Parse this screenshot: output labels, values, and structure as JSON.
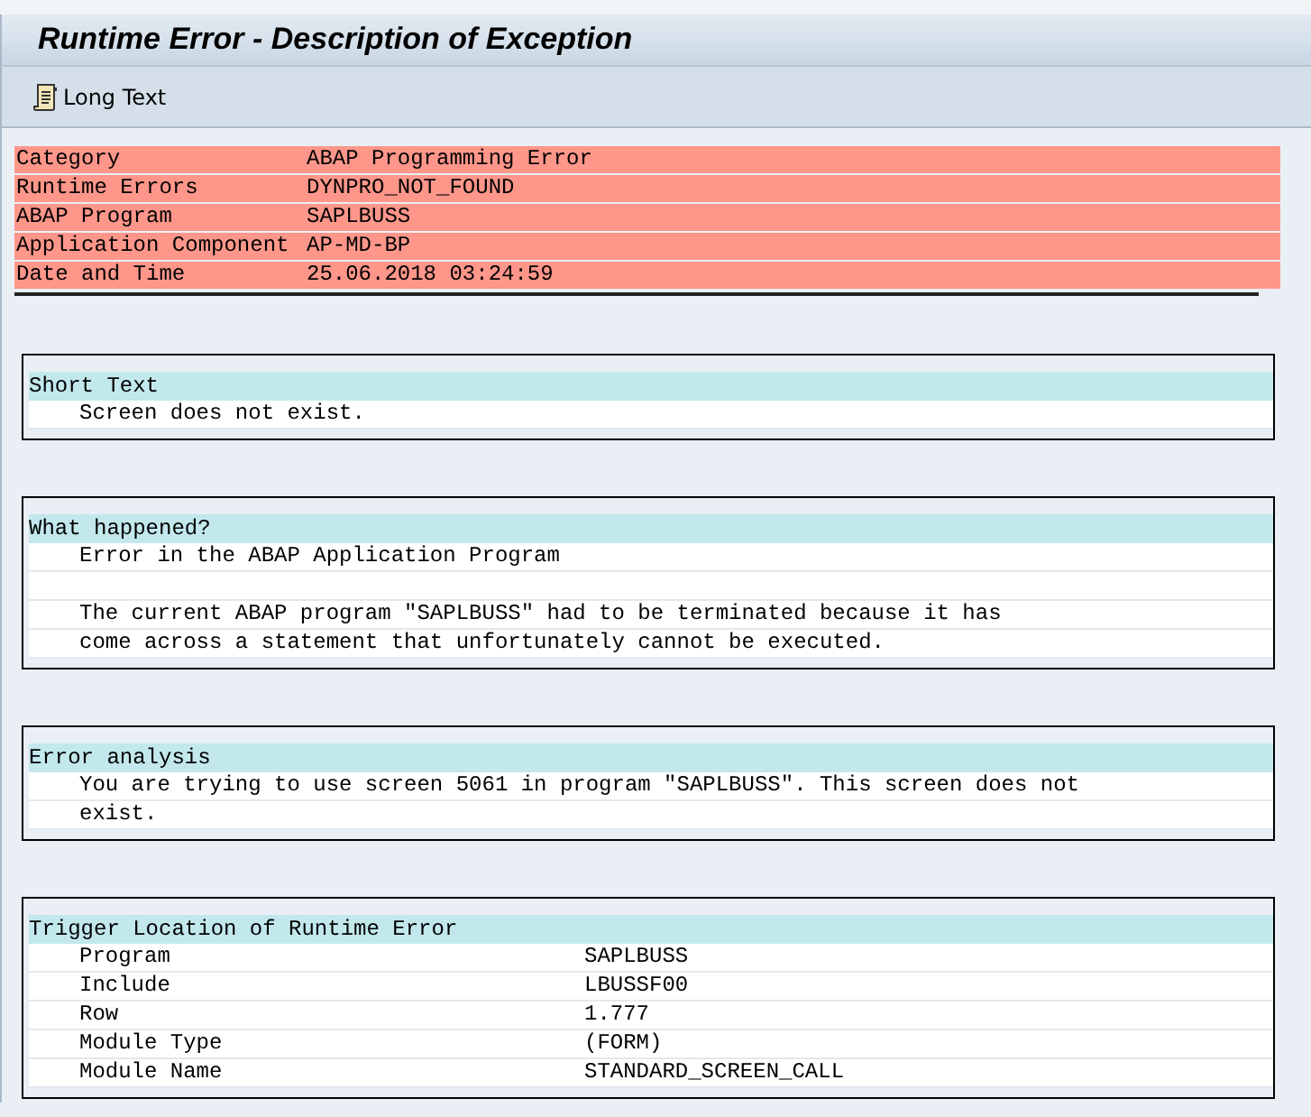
{
  "window": {
    "title": "Runtime Error - Description of Exception"
  },
  "toolbar": {
    "buttons": [
      {
        "label": "Long Text"
      }
    ]
  },
  "header": [
    {
      "label": "Category",
      "value": "ABAP Programming Error"
    },
    {
      "label": "Runtime Errors",
      "value": "DYNPRO_NOT_FOUND"
    },
    {
      "label": "ABAP Program",
      "value": "SAPLBUSS"
    },
    {
      "label": "Application Component",
      "value": "AP-MD-BP"
    },
    {
      "label": "Date and Time",
      "value": "25.06.2018 03:24:59"
    }
  ],
  "sections": [
    {
      "title": "Short Text",
      "lines": [
        {
          "kind": "text",
          "text": "Screen does not exist."
        }
      ]
    },
    {
      "title": "What happened?",
      "lines": [
        {
          "kind": "text",
          "text": "Error in the ABAP Application Program"
        },
        {
          "kind": "blank"
        },
        {
          "kind": "text",
          "text": "The current ABAP program \"SAPLBUSS\" had to be terminated because it has"
        },
        {
          "kind": "text",
          "text": "come across a statement that unfortunately cannot be executed."
        }
      ]
    },
    {
      "title": "Error analysis",
      "lines": [
        {
          "kind": "text",
          "text": "You are trying to use screen 5061 in program \"SAPLBUSS\". This screen does not"
        },
        {
          "kind": "text",
          "text": "exist."
        }
      ]
    },
    {
      "title": "Trigger Location of Runtime Error",
      "lines": [
        {
          "kind": "pair",
          "label": "Program",
          "value": "SAPLBUSS"
        },
        {
          "kind": "pair",
          "label": "Include",
          "value": "LBUSSF00"
        },
        {
          "kind": "pair",
          "label": "Row",
          "value": "1.777"
        },
        {
          "kind": "pair",
          "label": "Module Type",
          "value": "(FORM)"
        },
        {
          "kind": "pair",
          "label": "Module Name",
          "value": "STANDARD_SCREEN_CALL"
        }
      ]
    }
  ]
}
